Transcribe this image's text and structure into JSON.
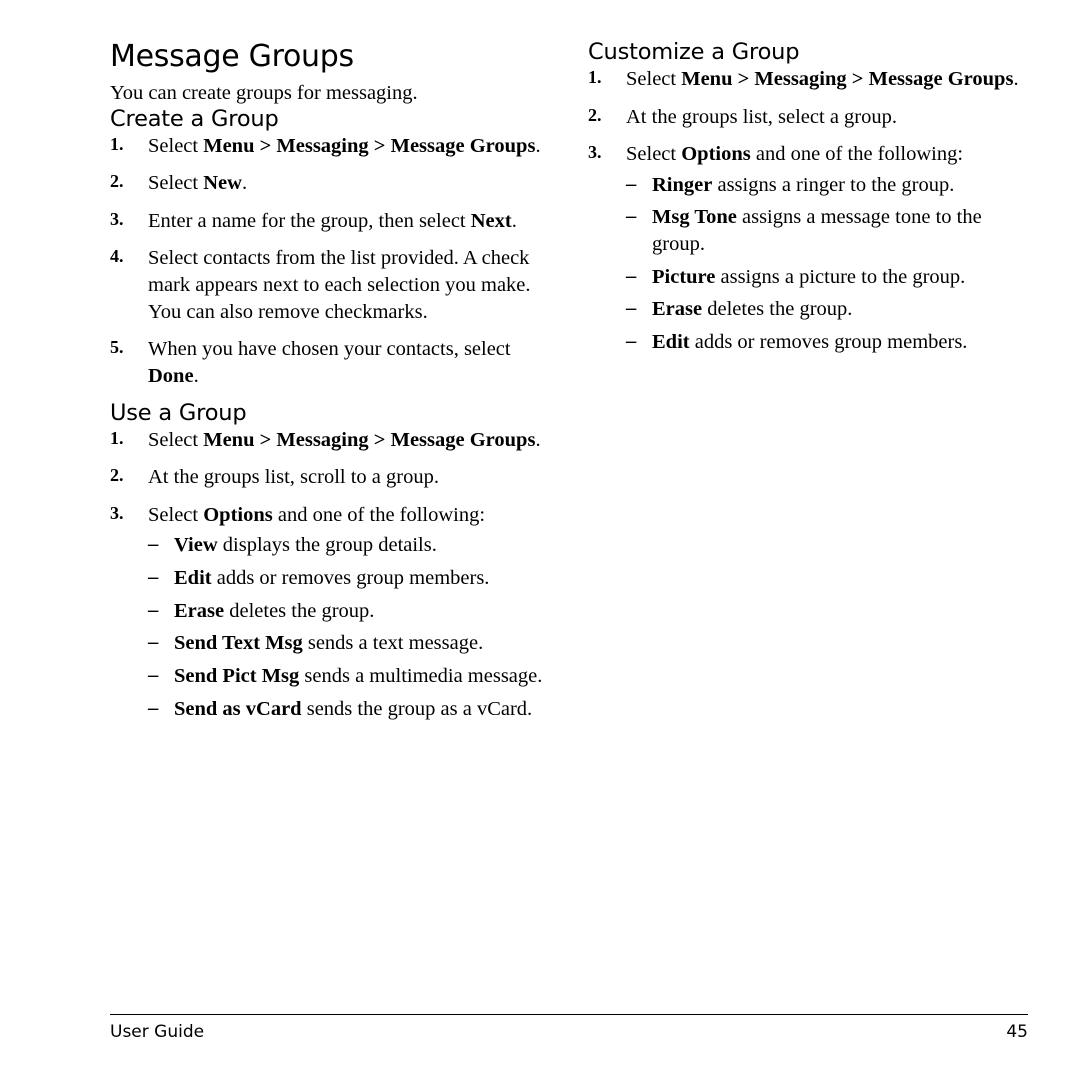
{
  "page": {
    "title": "Message Groups",
    "intro": "You can create groups for messaging.",
    "footer_left": "User Guide",
    "footer_page": "45"
  },
  "left_column": {
    "sections": [
      {
        "heading": "Create a Group",
        "steps": [
          {
            "num": "1.",
            "parts": [
              {
                "t": "Select ",
                "b": false
              },
              {
                "t": "Menu",
                "b": true
              },
              {
                "t": " > ",
                "b": true
              },
              {
                "t": "Messaging",
                "b": true
              },
              {
                "t": " > ",
                "b": true
              },
              {
                "t": "Message Groups",
                "b": true
              },
              {
                "t": ".",
                "b": false
              }
            ]
          },
          {
            "num": "2.",
            "parts": [
              {
                "t": "Select ",
                "b": false
              },
              {
                "t": "New",
                "b": true
              },
              {
                "t": ".",
                "b": false
              }
            ]
          },
          {
            "num": "3.",
            "parts": [
              {
                "t": "Enter a name for the group, then select ",
                "b": false
              },
              {
                "t": "Next",
                "b": true
              },
              {
                "t": ".",
                "b": false
              }
            ]
          },
          {
            "num": "4.",
            "parts": [
              {
                "t": "Select contacts from the list provided. A check mark appears next to each selection you make. You can also remove checkmarks.",
                "b": false
              }
            ]
          },
          {
            "num": "5.",
            "parts": [
              {
                "t": "When you have chosen your contacts, select ",
                "b": false
              },
              {
                "t": "Done",
                "b": true
              },
              {
                "t": ".",
                "b": false
              }
            ]
          }
        ]
      },
      {
        "heading": "Use a Group",
        "steps": [
          {
            "num": "1.",
            "parts": [
              {
                "t": "Select ",
                "b": false
              },
              {
                "t": "Menu",
                "b": true
              },
              {
                "t": " > ",
                "b": true
              },
              {
                "t": "Messaging",
                "b": true
              },
              {
                "t": " > ",
                "b": true
              },
              {
                "t": "Message Groups",
                "b": true
              },
              {
                "t": ".",
                "b": false
              }
            ]
          },
          {
            "num": "2.",
            "parts": [
              {
                "t": "At the groups list, scroll to a group.",
                "b": false
              }
            ]
          },
          {
            "num": "3.",
            "parts": [
              {
                "t": "Select ",
                "b": false
              },
              {
                "t": "Options",
                "b": true
              },
              {
                "t": " and one of the following:",
                "b": false
              }
            ],
            "sub": [
              [
                {
                  "t": "View",
                  "b": true
                },
                {
                  "t": " displays the group details.",
                  "b": false
                }
              ],
              [
                {
                  "t": "Edit",
                  "b": true
                },
                {
                  "t": " adds or removes group members.",
                  "b": false
                }
              ],
              [
                {
                  "t": "Erase",
                  "b": true
                },
                {
                  "t": " deletes the group.",
                  "b": false
                }
              ],
              [
                {
                  "t": "Send Text Msg",
                  "b": true
                },
                {
                  "t": " sends a text message.",
                  "b": false
                }
              ],
              [
                {
                  "t": "Send Pict Msg",
                  "b": true
                },
                {
                  "t": " sends a multimedia message.",
                  "b": false
                }
              ],
              [
                {
                  "t": "Send as vCard",
                  "b": true
                },
                {
                  "t": " sends the group as a vCard.",
                  "b": false
                }
              ]
            ]
          }
        ]
      }
    ]
  },
  "right_column": {
    "sections": [
      {
        "heading": "Customize a Group",
        "steps": [
          {
            "num": "1.",
            "parts": [
              {
                "t": "Select ",
                "b": false
              },
              {
                "t": "Menu",
                "b": true
              },
              {
                "t": " > ",
                "b": true
              },
              {
                "t": "Messaging",
                "b": true
              },
              {
                "t": " > ",
                "b": true
              },
              {
                "t": "Message Groups",
                "b": true
              },
              {
                "t": ".",
                "b": false
              }
            ]
          },
          {
            "num": "2.",
            "parts": [
              {
                "t": "At the groups list, select a group.",
                "b": false
              }
            ]
          },
          {
            "num": "3.",
            "parts": [
              {
                "t": "Select ",
                "b": false
              },
              {
                "t": "Options",
                "b": true
              },
              {
                "t": " and one of the following:",
                "b": false
              }
            ],
            "sub": [
              [
                {
                  "t": "Ringer",
                  "b": true
                },
                {
                  "t": " assigns a ringer to the group.",
                  "b": false
                }
              ],
              [
                {
                  "t": "Msg Tone",
                  "b": true
                },
                {
                  "t": " assigns a message tone to the group.",
                  "b": false
                }
              ],
              [
                {
                  "t": "Picture",
                  "b": true
                },
                {
                  "t": " assigns a picture to the group.",
                  "b": false
                }
              ],
              [
                {
                  "t": "Erase",
                  "b": true
                },
                {
                  "t": " deletes the group.",
                  "b": false
                }
              ],
              [
                {
                  "t": "Edit",
                  "b": true
                },
                {
                  "t": " adds or removes group members.",
                  "b": false
                }
              ]
            ]
          }
        ]
      }
    ]
  }
}
